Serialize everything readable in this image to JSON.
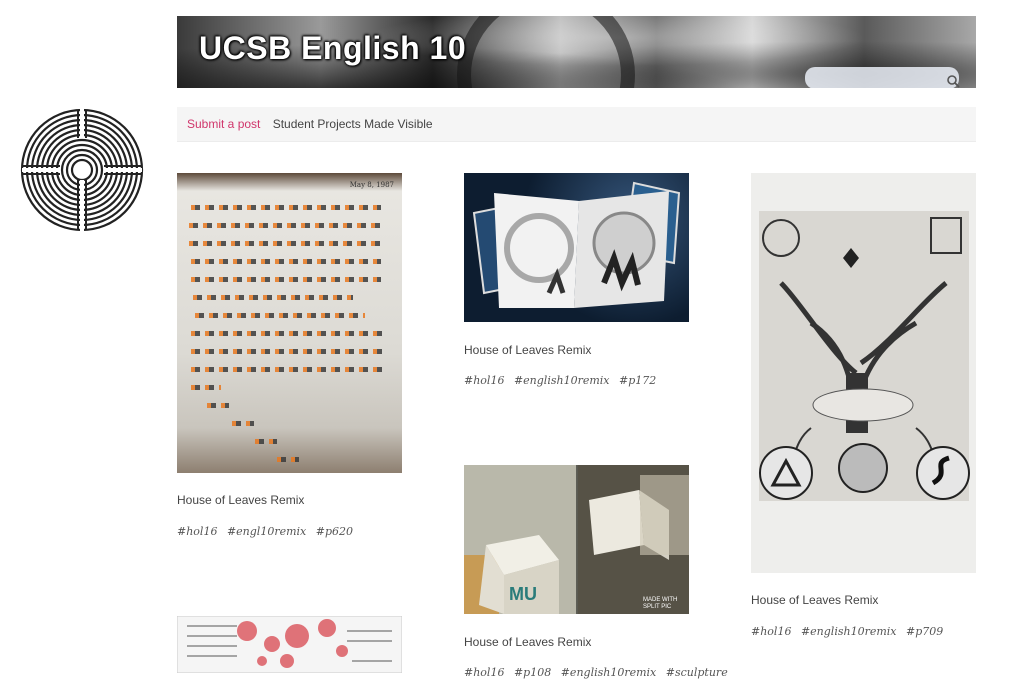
{
  "header": {
    "site_title": "UCSB English 10",
    "search_placeholder": ""
  },
  "nav": {
    "submit_label": "Submit a post",
    "description": "Student Projects Made Visible"
  },
  "posts": [
    {
      "title": "House of Leaves Remix",
      "tags": [
        "#hol16",
        "#engl10remix",
        "#p620"
      ]
    },
    {
      "title": "House of Leaves Remix",
      "tags": [
        "#hol16",
        "#english10remix",
        "#p172"
      ]
    },
    {
      "title": "House of Leaves Remix",
      "tags": [
        "#hol16",
        "#english10remix",
        "#p709"
      ]
    },
    {
      "title": "House of Leaves Remix",
      "tags": [
        "#hol16",
        "#p108",
        "#english10remix",
        "#sculpture"
      ]
    },
    {
      "title": "",
      "tags": []
    }
  ],
  "image_captions": {
    "paper_date": "May 8, 1987",
    "cube_watermark": "MADE WITH SPLIT PIC"
  },
  "colors": {
    "accent": "#d0356b",
    "nav_bg": "#f5f5f5"
  },
  "icons": {
    "logo": "labyrinth-icon",
    "search": "search-icon"
  }
}
